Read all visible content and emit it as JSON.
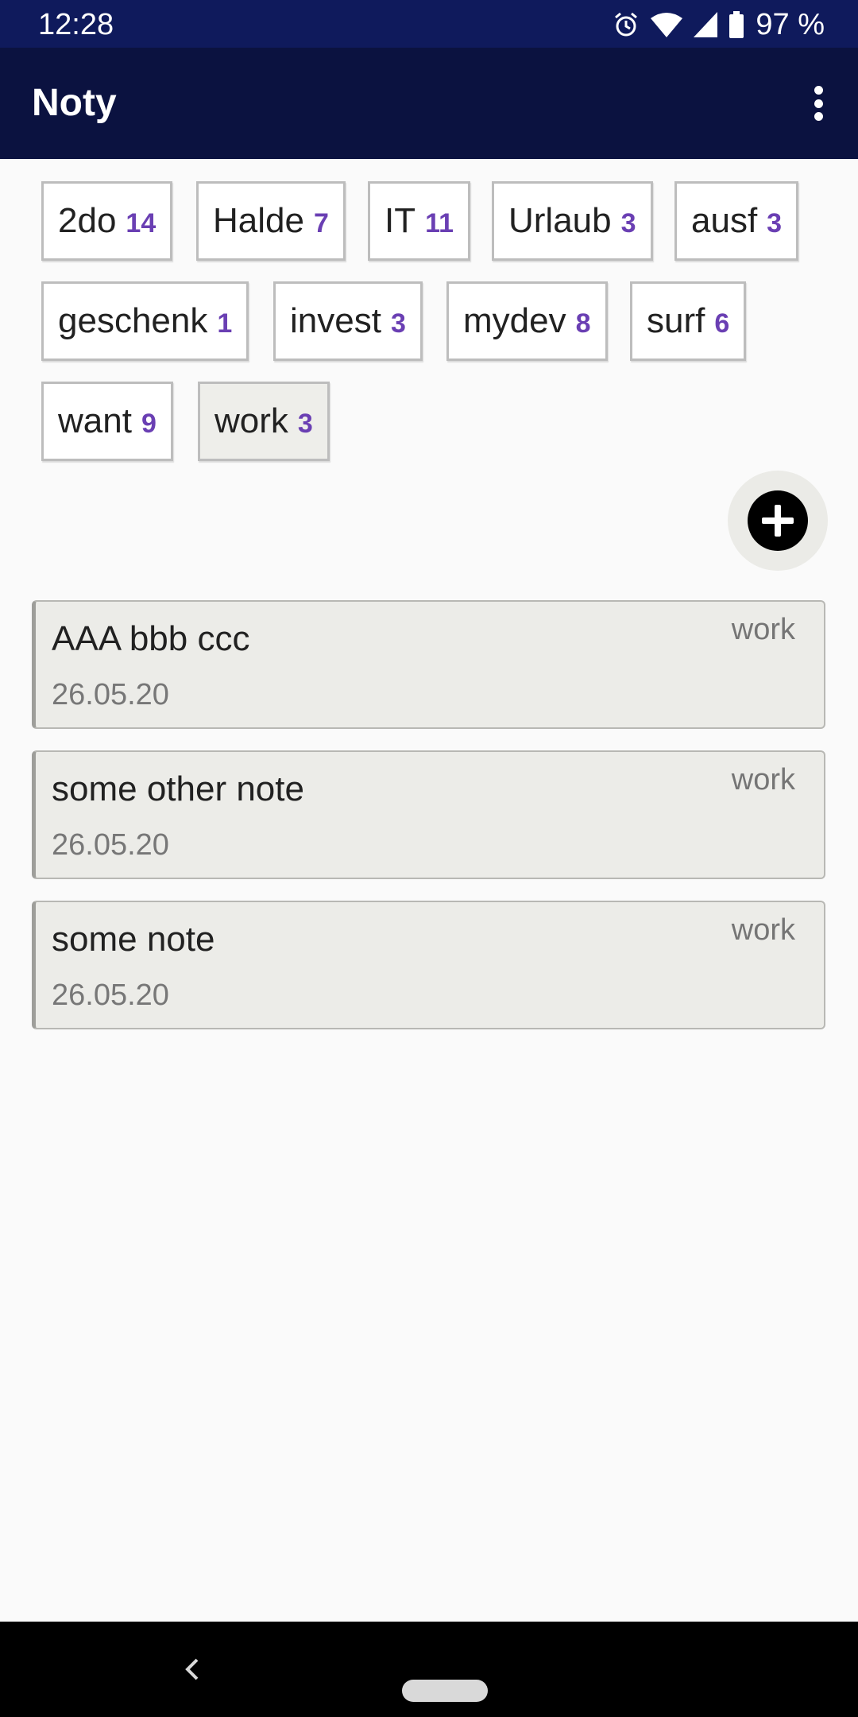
{
  "status": {
    "time": "12:28",
    "battery": "97 %"
  },
  "appbar": {
    "title": "Noty"
  },
  "tags": [
    {
      "name": "2do",
      "count": "14"
    },
    {
      "name": "Halde",
      "count": "7"
    },
    {
      "name": "IT",
      "count": "11"
    },
    {
      "name": "Urlaub",
      "count": "3"
    },
    {
      "name": "ausf",
      "count": "3"
    },
    {
      "name": "geschenk",
      "count": "1"
    },
    {
      "name": "invest",
      "count": "3"
    },
    {
      "name": "mydev",
      "count": "8"
    },
    {
      "name": "surf",
      "count": "6"
    },
    {
      "name": "want",
      "count": "9"
    },
    {
      "name": "work",
      "count": "3",
      "selected": true
    }
  ],
  "notes": [
    {
      "title": "AAA bbb ccc",
      "date": "26.05.20",
      "tag": "work"
    },
    {
      "title": "some other note",
      "date": "26.05.20",
      "tag": "work"
    },
    {
      "title": "some note",
      "date": "26.05.20",
      "tag": "work"
    }
  ],
  "icons": {
    "alarm": "alarm-icon",
    "wifi": "wifi-icon",
    "signal": "signal-icon",
    "battery": "battery-icon",
    "menu": "more-vert-icon",
    "add": "add-circle-icon",
    "back": "back-icon",
    "home": "home-pill-icon"
  },
  "colors": {
    "statusbar": "#0f1a5c",
    "appbar": "#0b1240",
    "count": "#6a3fb3",
    "note_bg": "#ecece8"
  }
}
